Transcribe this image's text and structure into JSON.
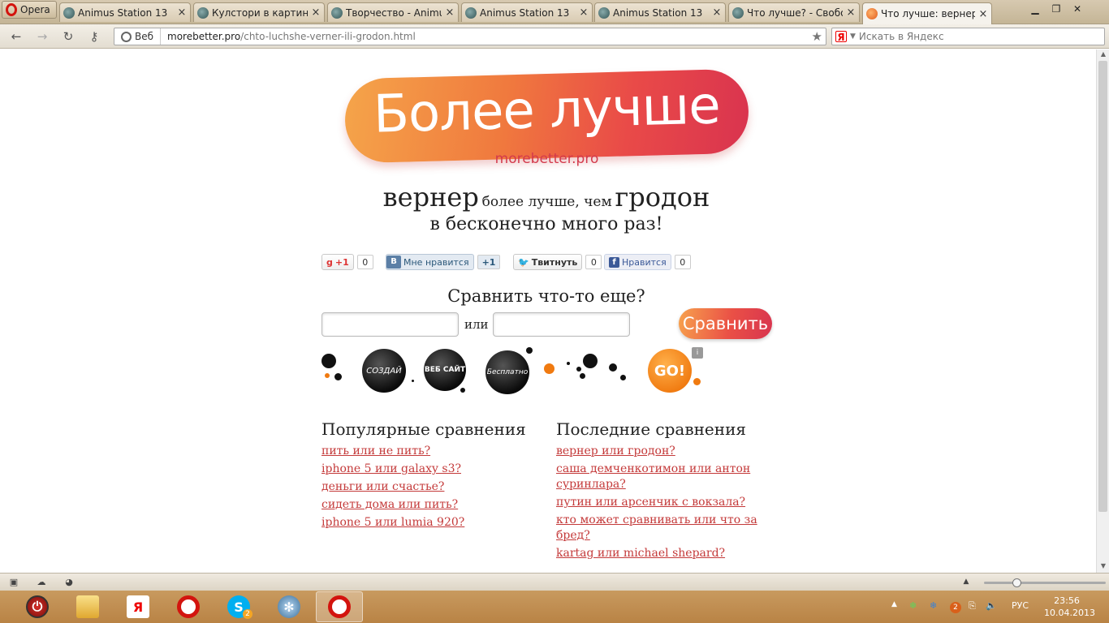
{
  "browser": {
    "menu_label": "Opera",
    "tabs": [
      {
        "title": "Animus Station 13",
        "active": false
      },
      {
        "title": "Кулстори в картинка...",
        "active": false
      },
      {
        "title": "Творчество - Animu...",
        "active": false
      },
      {
        "title": "Animus Station 13",
        "active": false
      },
      {
        "title": "Animus Station 13",
        "active": false
      },
      {
        "title": "Что лучше? - Свобо...",
        "active": false
      },
      {
        "title": "Что лучше: вернер ...",
        "active": true
      }
    ],
    "address": {
      "mode_label": "Веб",
      "domain": "morebetter.pro",
      "path": "/chto-luchshe-verner-ili-grodon.html"
    },
    "search_placeholder": "Искать в Яндекс",
    "search_engine_letter": "Я"
  },
  "page": {
    "logo_text": "Более лучше",
    "logo_sub": "morebetter.pro",
    "headline": {
      "item1": "вернер",
      "middle": "более лучше, чем",
      "item2": "гродон"
    },
    "subline": "в бесконечно много раз!",
    "social": {
      "google_label": "+1",
      "google_count": "0",
      "vk_label": "Мне нравится",
      "vk_plus": "+1",
      "twitter_label": "Твитнуть",
      "twitter_count": "0",
      "facebook_label": "Нравится",
      "facebook_count": "0"
    },
    "compare": {
      "title": "Сравнить что-то еще?",
      "or_label": "или",
      "input1_value": "",
      "input2_value": "",
      "button_label": "Сравнить"
    },
    "ad": {
      "word1": "СОЗДАЙ",
      "word2": "ВЕБ САЙТ",
      "word3": "Бесплатно",
      "go_label": "GO!",
      "info_label": "i"
    },
    "popular": {
      "title": "Популярные сравнения",
      "links": [
        "пить или не пить?",
        "iphone 5 или galaxy s3?",
        "деньги или счастье?",
        "сидеть дома или пить?",
        "iphone 5 или lumia 920?"
      ]
    },
    "recent": {
      "title": "Последние сравнения",
      "links": [
        "вернер или гродон?",
        "саша демченкотимон или антон суринлара?",
        "путин или арсенчик с вокзала?",
        "кто может сравнивать или что за бред?",
        "kartag или michael shepard?"
      ]
    }
  },
  "taskbar": {
    "lang": "РУС",
    "time": "23:56",
    "date": "10.04.2013",
    "skype_badge": "2",
    "tray_badge": "2"
  }
}
